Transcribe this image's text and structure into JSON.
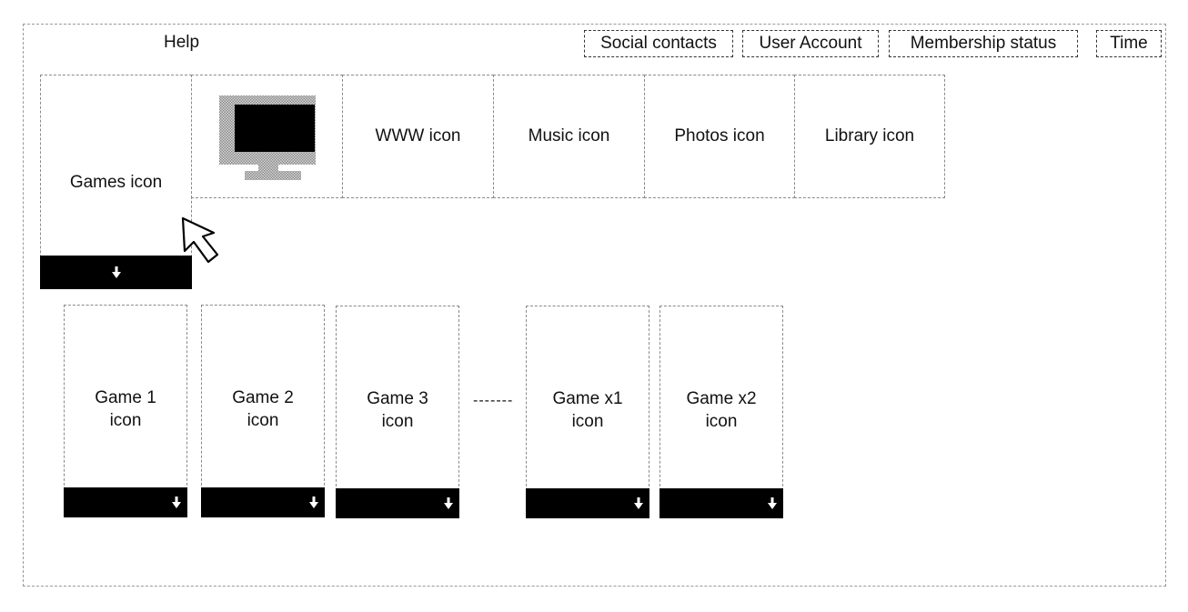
{
  "header": {
    "help_label": "Help",
    "buttons": [
      {
        "label": "Social contacts"
      },
      {
        "label": "User Account"
      },
      {
        "label": "Membership status"
      },
      {
        "label": "Time"
      }
    ]
  },
  "top_row": {
    "games": {
      "label": "Games icon",
      "icon": "chevron-down-icon"
    },
    "tv": {
      "icon": "monitor-icon"
    },
    "tiles": [
      {
        "label": "WWW icon"
      },
      {
        "label": "Music icon"
      },
      {
        "label": "Photos icon"
      },
      {
        "label": "Library icon"
      }
    ]
  },
  "games_list": {
    "items": [
      {
        "line1": "Game 1",
        "line2": "icon"
      },
      {
        "line1": "Game 2",
        "line2": "icon"
      },
      {
        "line1": "Game 3",
        "line2": "icon"
      },
      {
        "line1": "Game x1",
        "line2": "icon"
      },
      {
        "line1": "Game x2",
        "line2": "icon"
      }
    ],
    "ellipsis": "-------"
  },
  "colors": {
    "bar": "#000000",
    "tv_frame": "#b0b0b0",
    "tv_screen": "#000000"
  }
}
